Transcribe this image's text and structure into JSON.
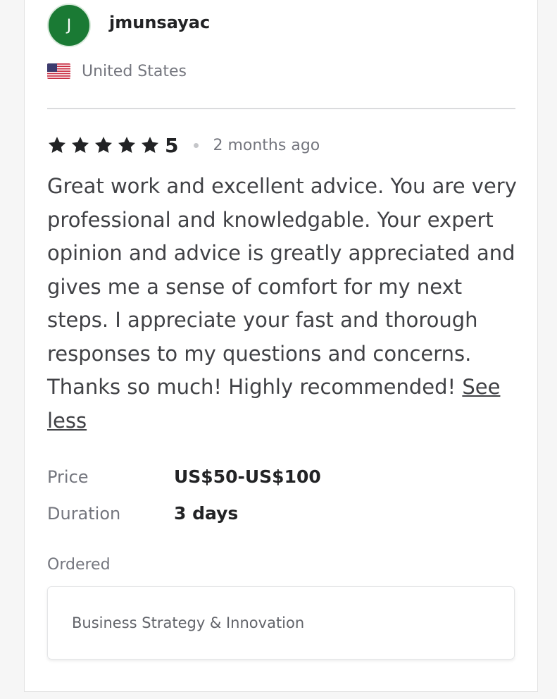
{
  "reviewer": {
    "avatar_letter": "J",
    "avatar_color": "#1a7a34",
    "username": "jmunsayac",
    "country": "United States",
    "flag_icon": "us-flag-icon"
  },
  "rating": {
    "stars": 5,
    "value": "5",
    "time_ago": "2 months ago",
    "star_color": "#222325"
  },
  "review": {
    "text": "Great work and excellent advice. You are very professional and knowledgable. Your expert opinion and advice is greatly appreciated and gives me a sense of comfort for my next steps. I appreciate your fast and thorough responses to my questions and concerns. Thanks so much! Highly recommended! ",
    "toggle_label": "See less"
  },
  "details": {
    "price_label": "Price",
    "price_value": "US$50-US$100",
    "duration_label": "Duration",
    "duration_value": "3 days"
  },
  "ordered": {
    "label": "Ordered",
    "service": "Business Strategy & Innovation"
  }
}
